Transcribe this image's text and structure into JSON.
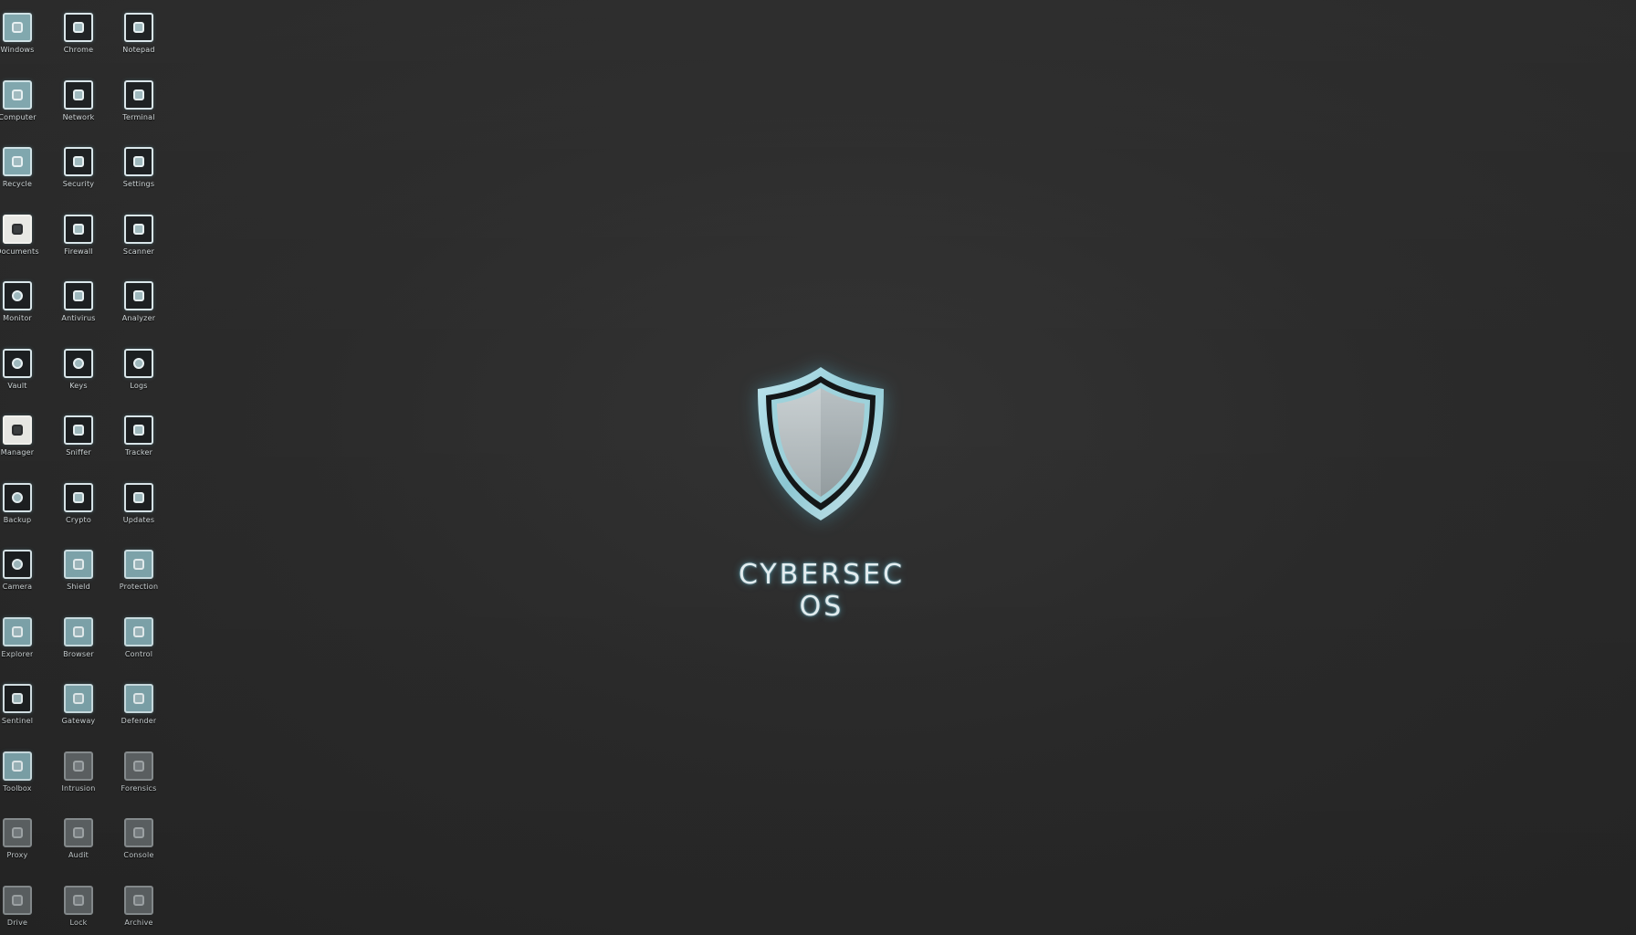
{
  "brand": {
    "title": "CYBERSEC OS"
  },
  "icons": {
    "rows": [
      [
        "Windows",
        "Chrome",
        "Notepad"
      ],
      [
        "Computer",
        "Network",
        "Terminal"
      ],
      [
        "Recycle",
        "Security",
        "Settings"
      ],
      [
        "Documents",
        "Firewall",
        "Scanner"
      ],
      [
        "Monitor",
        "Antivirus",
        "Analyzer"
      ],
      [
        "Vault",
        "Keys",
        "Logs"
      ],
      [
        "Manager",
        "Sniffer",
        "Tracker"
      ],
      [
        "Backup",
        "Crypto",
        "Updates"
      ],
      [
        "Camera",
        "Shield",
        "Protection"
      ],
      [
        "Explorer",
        "Browser",
        "Control"
      ],
      [
        "Sentinel",
        "Gateway",
        "Defender"
      ],
      [
        "Toolbox",
        "Intrusion",
        "Forensics"
      ],
      [
        "Proxy",
        "Audit",
        "Console"
      ],
      [
        "Drive",
        "Lock",
        "Archive"
      ]
    ]
  },
  "colors": {
    "background": "#2a2a2a",
    "accent_glow": "#5ac8e6",
    "shield_fill": "#b4bcbf",
    "shield_rim": "#8ecad6"
  }
}
